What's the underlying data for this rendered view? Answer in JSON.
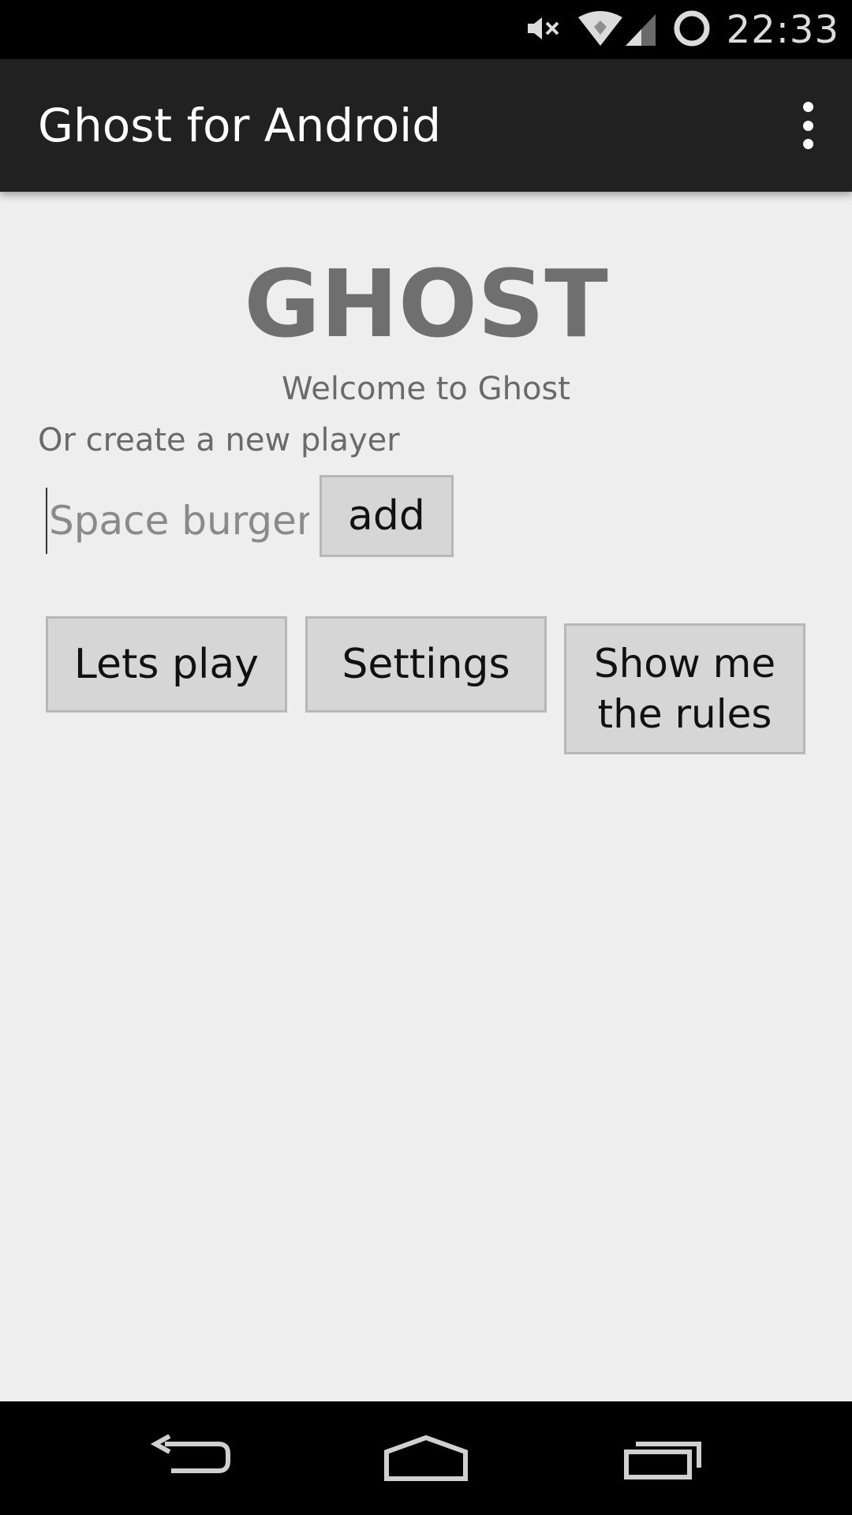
{
  "status_bar": {
    "time": "22:33",
    "icons": [
      "mute-icon",
      "wifi-icon",
      "signal-icon",
      "sync-icon"
    ]
  },
  "action_bar": {
    "title": "Ghost for Android",
    "overflow_icon": "more-vert-icon"
  },
  "main": {
    "logo_text": "GHOST",
    "welcome_text": "Welcome to Ghost",
    "create_label": "Or create a new player",
    "player_input": {
      "value": "",
      "placeholder": "Space burger"
    },
    "add_button_label": "add",
    "buttons": {
      "play_label": "Lets play",
      "settings_label": "Settings",
      "rules_label": "Show me the rules"
    }
  },
  "nav_bar": {
    "icons": [
      "back-icon",
      "home-icon",
      "recents-icon"
    ]
  },
  "colors": {
    "status_bar_bg": "#000000",
    "action_bar_bg": "#212121",
    "content_bg": "#eeeeee",
    "button_bg": "#d6d6d6",
    "logo_text": "#6f6f6f"
  }
}
